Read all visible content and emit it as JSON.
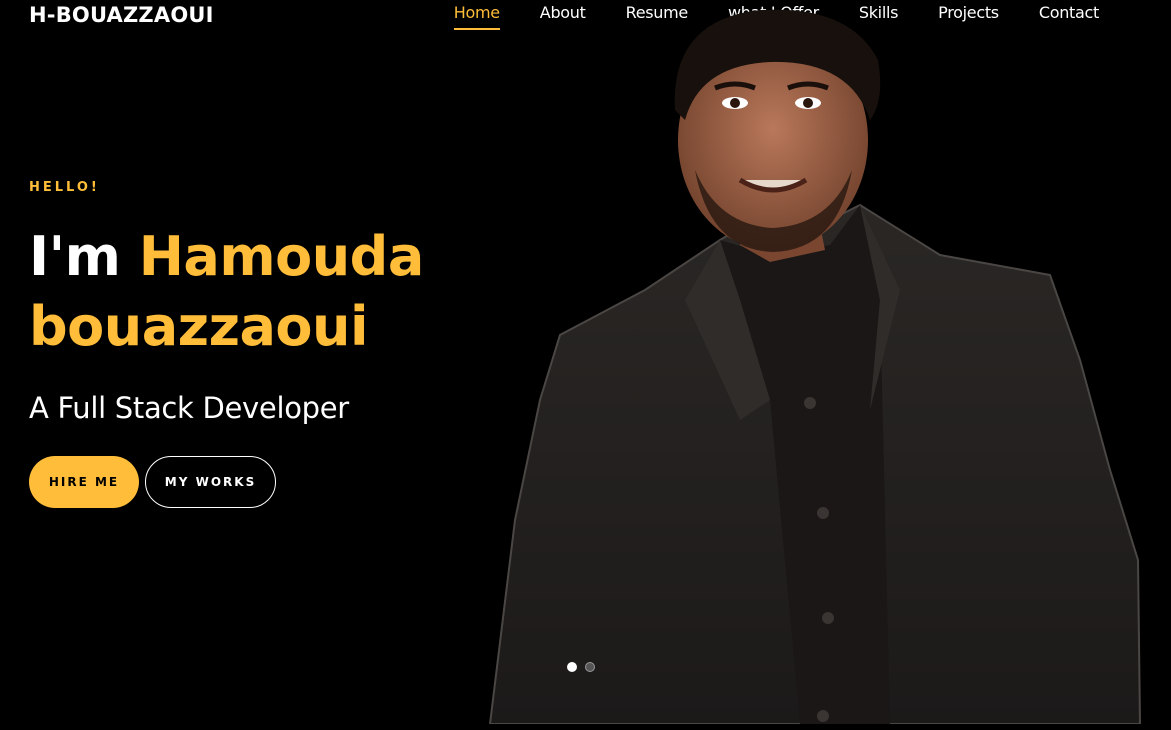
{
  "brand": {
    "logo": "H-BOUAZZAOUI"
  },
  "nav": {
    "items": [
      {
        "label": "Home",
        "active": true
      },
      {
        "label": "About"
      },
      {
        "label": "Resume"
      },
      {
        "label": "what I Offer"
      },
      {
        "label": "Skills"
      },
      {
        "label": "Projects"
      },
      {
        "label": "Contact"
      }
    ]
  },
  "hero": {
    "greeting": "HELLO!",
    "im": "I'm",
    "first_name": "Hamouda",
    "last_name": "bouazzaoui",
    "role": "A Full Stack Developer",
    "hire_label": "HIRE ME",
    "works_label": "MY WORKS"
  },
  "carousel": {
    "slides": 2,
    "active": 1
  },
  "colors": {
    "accent": "#ffbd39",
    "background": "#000000",
    "text": "#ffffff"
  }
}
